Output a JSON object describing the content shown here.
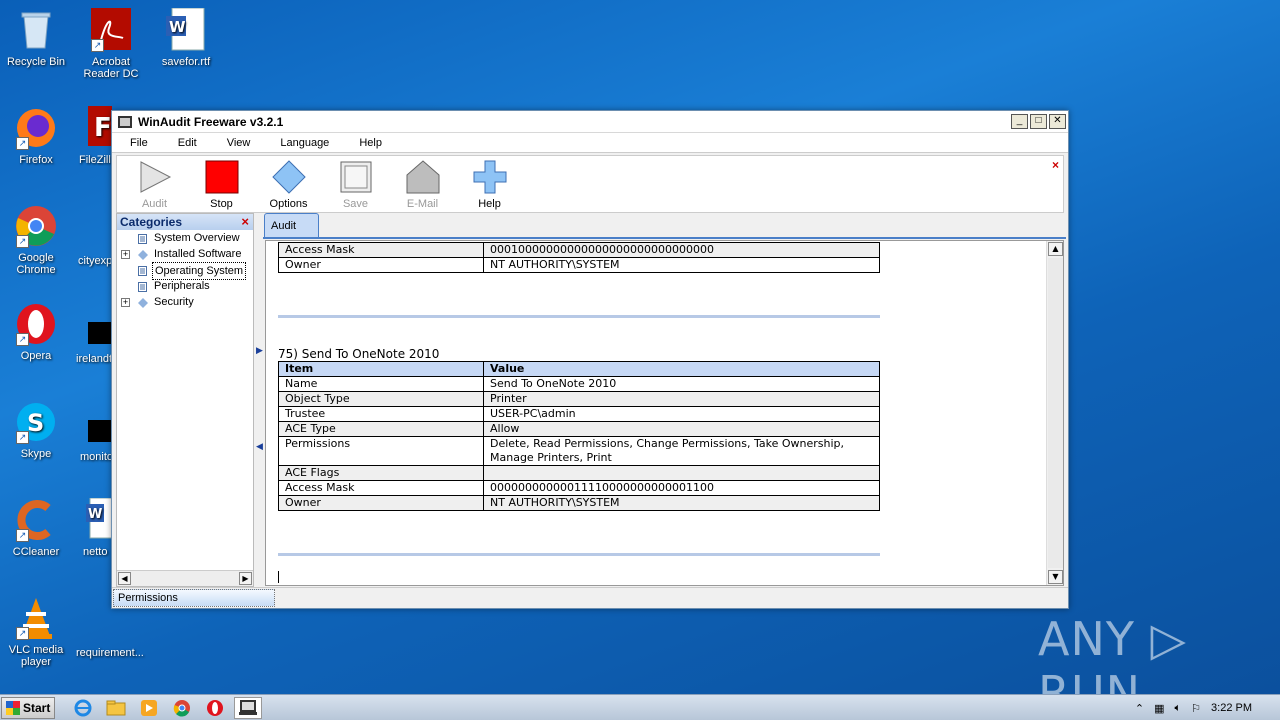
{
  "desktop": {
    "icons": [
      {
        "label": "Recycle Bin"
      },
      {
        "label": "Acrobat Reader DC"
      },
      {
        "label": "savefor.rtf"
      },
      {
        "label": "Firefox"
      },
      {
        "label": "FileZilla"
      },
      {
        "label": "Google Chrome"
      },
      {
        "label": "cityexp"
      },
      {
        "label": "Opera"
      },
      {
        "label": "irelandt"
      },
      {
        "label": "Skype"
      },
      {
        "label": "monito"
      },
      {
        "label": "CCleaner"
      },
      {
        "label": "netto"
      },
      {
        "label": "VLC media player"
      },
      {
        "label": "requirement..."
      }
    ]
  },
  "window": {
    "title": "WinAudit Freeware v3.2.1",
    "controls": {
      "minimize": "_",
      "maximize": "□",
      "close": "✕"
    },
    "menu": [
      "File",
      "Edit",
      "View",
      "Language",
      "Help"
    ],
    "toolbar": {
      "items": [
        {
          "label": "Audit",
          "enabled": false,
          "icon": "play-icon"
        },
        {
          "label": "Stop",
          "enabled": true,
          "icon": "stop-icon"
        },
        {
          "label": "Options",
          "enabled": true,
          "icon": "diamond-icon"
        },
        {
          "label": "Save",
          "enabled": false,
          "icon": "save-icon"
        },
        {
          "label": "E-Mail",
          "enabled": false,
          "icon": "house-icon"
        },
        {
          "label": "Help",
          "enabled": true,
          "icon": "plus-icon"
        }
      ],
      "close": "×"
    },
    "categories": {
      "header": "Categories",
      "close": "×",
      "items": [
        {
          "label": "System Overview",
          "expandable": false
        },
        {
          "label": "Installed Software",
          "expandable": true
        },
        {
          "label": "Operating System",
          "expandable": false,
          "selected": true
        },
        {
          "label": "Peripherals",
          "expandable": false
        },
        {
          "label": "Security",
          "expandable": true
        }
      ]
    },
    "tab": "Audit",
    "content": {
      "top_table": [
        {
          "item": "Access Mask",
          "value": "00010000000000000000000000000000"
        },
        {
          "item": "Owner",
          "value": "NT AUTHORITY\\SYSTEM"
        }
      ],
      "section_title": "75) Send To OneNote 2010",
      "table_header": {
        "item": "Item",
        "value": "Value"
      },
      "rows": [
        {
          "item": "Name",
          "value": "Send To OneNote 2010"
        },
        {
          "item": "Object Type",
          "value": "Printer"
        },
        {
          "item": "Trustee",
          "value": "USER-PC\\admin"
        },
        {
          "item": "ACE Type",
          "value": "Allow"
        },
        {
          "item": "Permissions",
          "value": "Delete, Read Permissions, Change Permissions, Take Ownership, Manage Printers, Print"
        },
        {
          "item": "ACE Flags",
          "value": ""
        },
        {
          "item": "Access Mask",
          "value": "00000000000011110000000000001100"
        },
        {
          "item": "Owner",
          "value": "NT AUTHORITY\\SYSTEM"
        }
      ]
    },
    "status": "Permissions"
  },
  "watermark": "ANY ▷ RUN",
  "taskbar": {
    "start": "Start",
    "clock": "3:22 PM"
  }
}
